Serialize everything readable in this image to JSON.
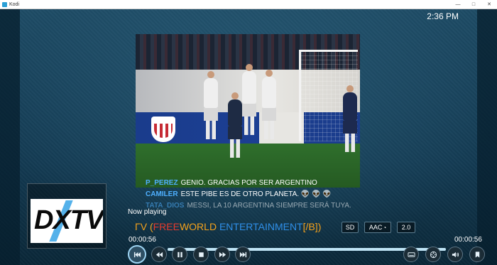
{
  "window": {
    "title": "Kodi",
    "minimize": "—",
    "maximize": "□",
    "close": "✕"
  },
  "clock": "2:36 PM",
  "chat": [
    {
      "user": "P_PEREZ",
      "message": "GENIO. GRACIAS POR SER ARGENTINO"
    },
    {
      "user": "CAMILER",
      "message": "ESTE PIBE ES DE OTRO PLANETA. 👽 👽 👽"
    },
    {
      "user": "TATA_DIOS",
      "message": "MESSI, LA 10 ARGENTINA SIEMPRE SERÁ TUYA."
    }
  ],
  "osd": {
    "now_playing_label": "Now playing",
    "track_parts": [
      {
        "text": "ΓV (",
        "color": "#f5a21b"
      },
      {
        "text": "FREE",
        "color": "#e53a2d"
      },
      {
        "text": "WORLD ",
        "color": "#f5a21b"
      },
      {
        "text": "ENTERTAINMENT",
        "color": "#2f8fe8"
      },
      {
        "text": "[/B]",
        "color": "#f5a21b"
      },
      {
        "text": ")",
        "color": "#f5a21b"
      }
    ],
    "badges": {
      "video": "SD",
      "audio": "AAC",
      "channels": "2.0"
    },
    "time_elapsed": "00:00:56",
    "time_total": "00:00:56",
    "progress": 1.0,
    "thumbnail_logo": "DXTV"
  },
  "controls": [
    "previous-icon",
    "rewind-icon",
    "pause-icon",
    "stop-icon",
    "fast-forward-icon",
    "next-icon",
    "subtitles-icon",
    "video-settings-icon",
    "volume-icon",
    "bookmark-icon"
  ]
}
